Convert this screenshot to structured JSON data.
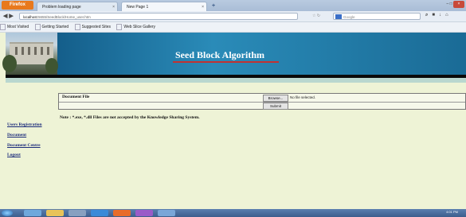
{
  "browser": {
    "app_button": "Firefox",
    "tabs": [
      {
        "label": "Problem loading page"
      },
      {
        "label": "New Page 1"
      }
    ],
    "new_tab": "+",
    "url_host": "localhost",
    "url_rest": ":5655/SeedBlock/Home_user.htm",
    "search_placeholder": "Google",
    "bookmarks": [
      "Most Visited",
      "Getting Started",
      "Suggested Sites",
      "Web Slice Gallery"
    ]
  },
  "banner": {
    "title": "Seed Block Algorithm"
  },
  "form": {
    "document_label": "Document File",
    "browse_label": "Browse...",
    "no_file_text": "No file selected.",
    "submit_label": "Submit",
    "note": "Note : *.exe, *.dll Files are not accepted by the Knowledge Sharing System."
  },
  "sidebar": {
    "items": [
      {
        "label": "Users Registration"
      },
      {
        "label": "Document"
      },
      {
        "label": "Document Centre"
      },
      {
        "label": "Logout"
      }
    ]
  },
  "taskbar": {
    "clock": "4:01 PM"
  }
}
